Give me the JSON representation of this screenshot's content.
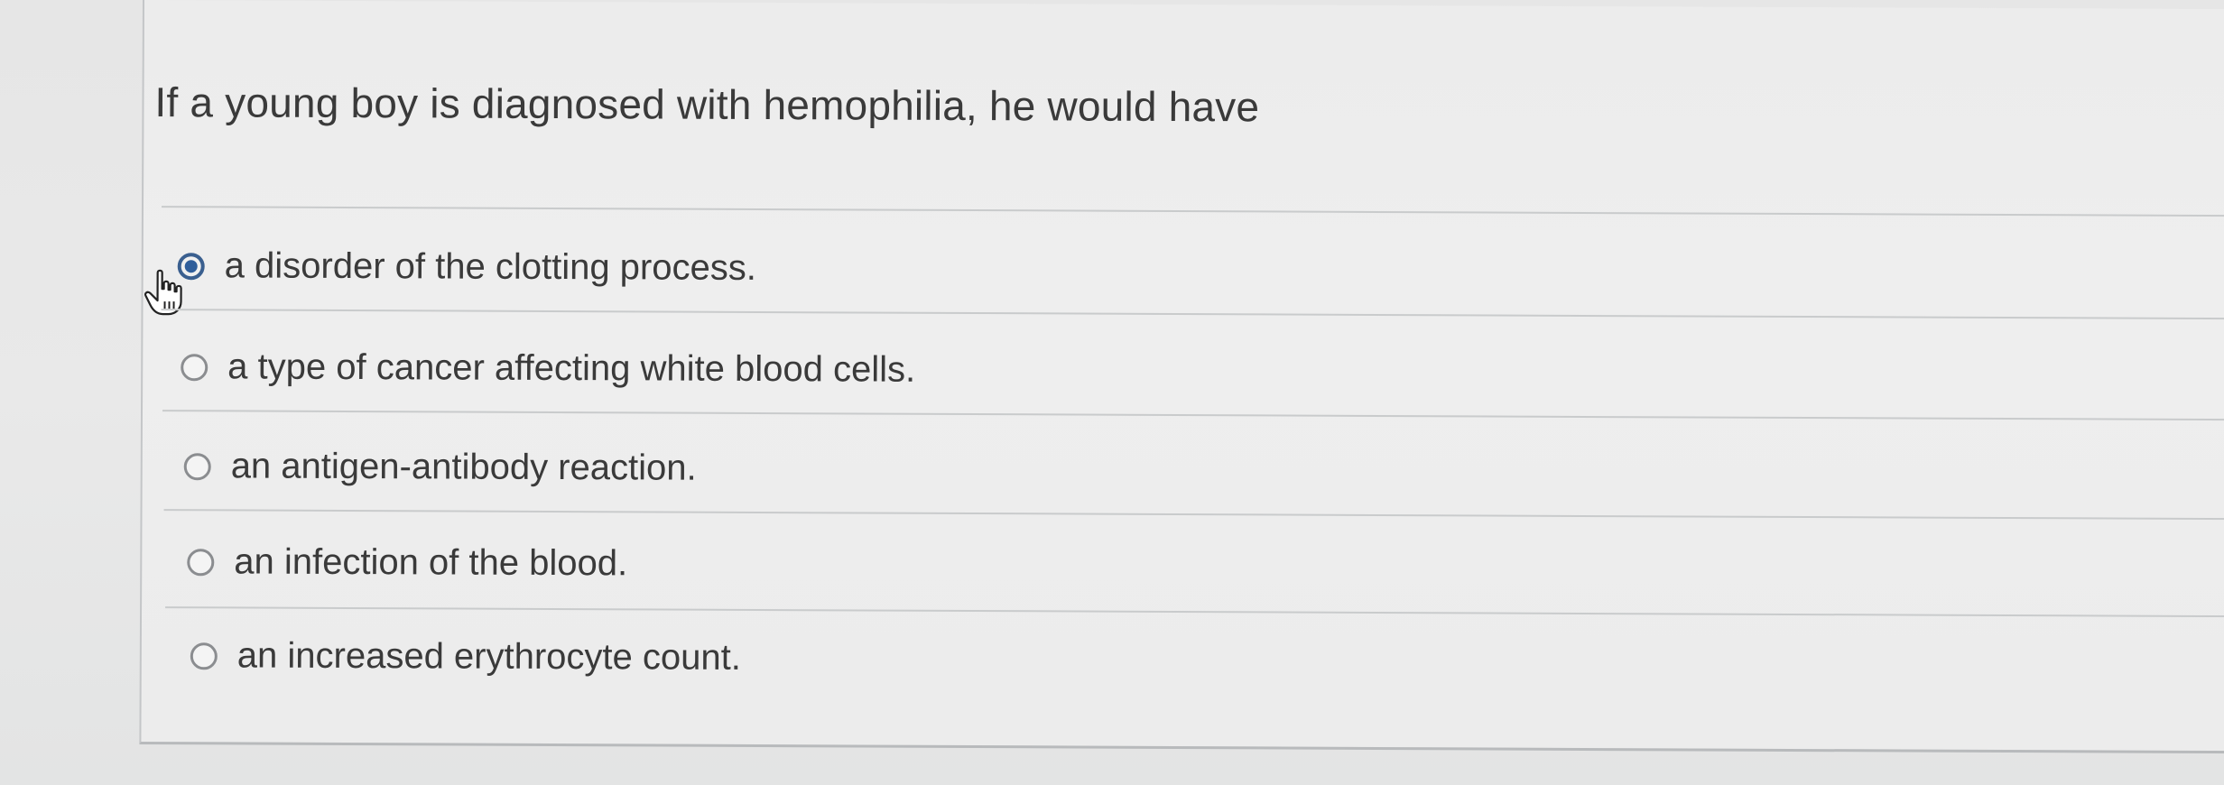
{
  "question": {
    "text": "If a young boy is diagnosed with hemophilia, he would have"
  },
  "options": [
    {
      "label": "a disorder of the clotting process.",
      "selected": true
    },
    {
      "label": "a type of cancer affecting white blood cells.",
      "selected": false
    },
    {
      "label": "an antigen-antibody reaction.",
      "selected": false
    },
    {
      "label": "an infection of the blood.",
      "selected": false
    },
    {
      "label": "an increased erythrocyte count.",
      "selected": false
    }
  ],
  "cursor": {
    "icon": "hand-pointer-icon"
  },
  "colors": {
    "selected_radio": "#2f5e9b",
    "text": "#3a3a3a",
    "divider": "#c9cbcc",
    "background": "#ececec"
  }
}
